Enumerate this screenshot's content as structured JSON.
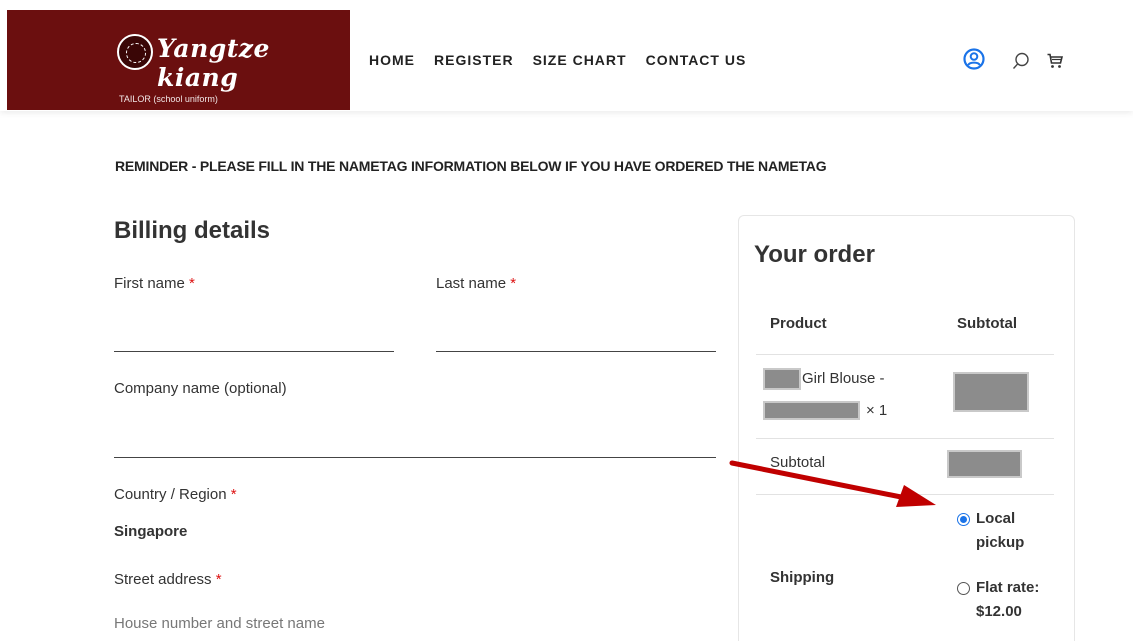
{
  "brand": {
    "logo_text": "Yangtze kiang",
    "logo_subtitle": "TAILOR (school uniform)"
  },
  "nav": {
    "items": [
      {
        "label": "HOME"
      },
      {
        "label": "REGISTER"
      },
      {
        "label": "SIZE CHART"
      },
      {
        "label": "CONTACT US"
      }
    ]
  },
  "header_icons": {
    "account": "account-icon",
    "search": "search-icon",
    "cart": "cart-icon",
    "accent_color": "#1a73e8"
  },
  "reminder": "REMINDER - PLEASE FILL IN THE NAMETAG INFORMATION BELOW IF YOU HAVE ORDERED THE NAMETAG",
  "billing": {
    "title": "Billing details",
    "required_mark": "*",
    "first_name_label": "First name",
    "last_name_label": "Last name",
    "company_label": "Company name (optional)",
    "country_label": "Country / Region",
    "country_value": "Singapore",
    "street_label": "Street address",
    "street_placeholder": "House number and street name"
  },
  "order": {
    "title": "Your order",
    "col_product": "Product",
    "col_subtotal": "Subtotal",
    "item_name": "Girl Blouse -",
    "item_qty": "× 1",
    "subtotal_label": "Subtotal",
    "shipping_label": "Shipping",
    "shipping_options": [
      {
        "line1": "Local",
        "line2": "pickup",
        "selected": true
      },
      {
        "line1": "Flat rate:",
        "line2": "$12.00",
        "selected": false
      }
    ]
  },
  "colors": {
    "logo_bg": "#6b0f0f",
    "required": "#dd1111",
    "arrow": "#c00000"
  }
}
